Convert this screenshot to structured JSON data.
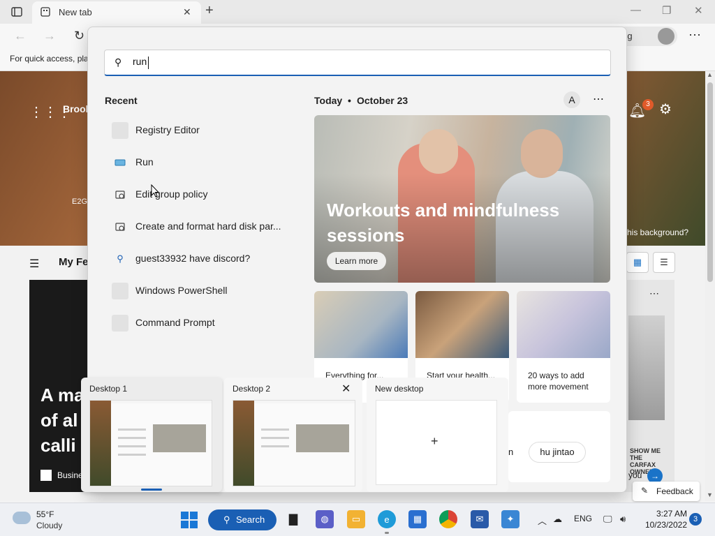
{
  "browser": {
    "tab_title": "New tab",
    "profile_text": "yncing",
    "favorites_text": "For quick access, pla"
  },
  "ntp": {
    "brand": "Brook",
    "e2g": "E2G",
    "notification_count": "3",
    "background_link": "his background?",
    "myfeed_label": "My Fe",
    "story_headline": "A ma of al calli",
    "story_source": "Busine",
    "carfax_text": "SHOW ME THE CARFAX OWNER",
    "you_text": "you",
    "feedback_label": "Feedback"
  },
  "search": {
    "query": "run",
    "recent_heading": "Recent",
    "recent_items": [
      {
        "label": "Registry Editor",
        "icon": "registry-icon"
      },
      {
        "label": "Run",
        "icon": "run-icon"
      },
      {
        "label": "Edit group policy",
        "icon": "settings-app-icon"
      },
      {
        "label": "Create and format hard disk par...",
        "icon": "settings-app-icon"
      },
      {
        "label": "guest33932 have discord?",
        "icon": "search-icon"
      },
      {
        "label": "Windows PowerShell",
        "icon": "powershell-icon"
      },
      {
        "label": "Command Prompt",
        "icon": "cmd-icon"
      }
    ],
    "today_heading": "Today",
    "today_sep": "•",
    "today_date": "October 23",
    "user_initial": "A",
    "main_card_title": "Workouts and mindfulness sessions",
    "learn_more": "Learn more",
    "small_cards": [
      {
        "text": "Everything for..."
      },
      {
        "text": "Start your health..."
      },
      {
        "text": "20 ways to add more movement"
      }
    ],
    "trending_pill": "hu jintao",
    "trending_fragment": "n"
  },
  "desktops": [
    {
      "label": "Desktop 1"
    },
    {
      "label": "Desktop 2"
    },
    {
      "label": "New desktop"
    }
  ],
  "taskbar": {
    "weather_temp": "55°F",
    "weather_cond": "Cloudy",
    "search_label": "Search",
    "lang": "ENG",
    "time": "3:27 AM",
    "date": "10/23/2022",
    "notif_count": "3"
  },
  "colors": {
    "accent": "#1a5fb4",
    "start_blue": "#1a78d6",
    "badge_orange": "#e05a2a"
  }
}
